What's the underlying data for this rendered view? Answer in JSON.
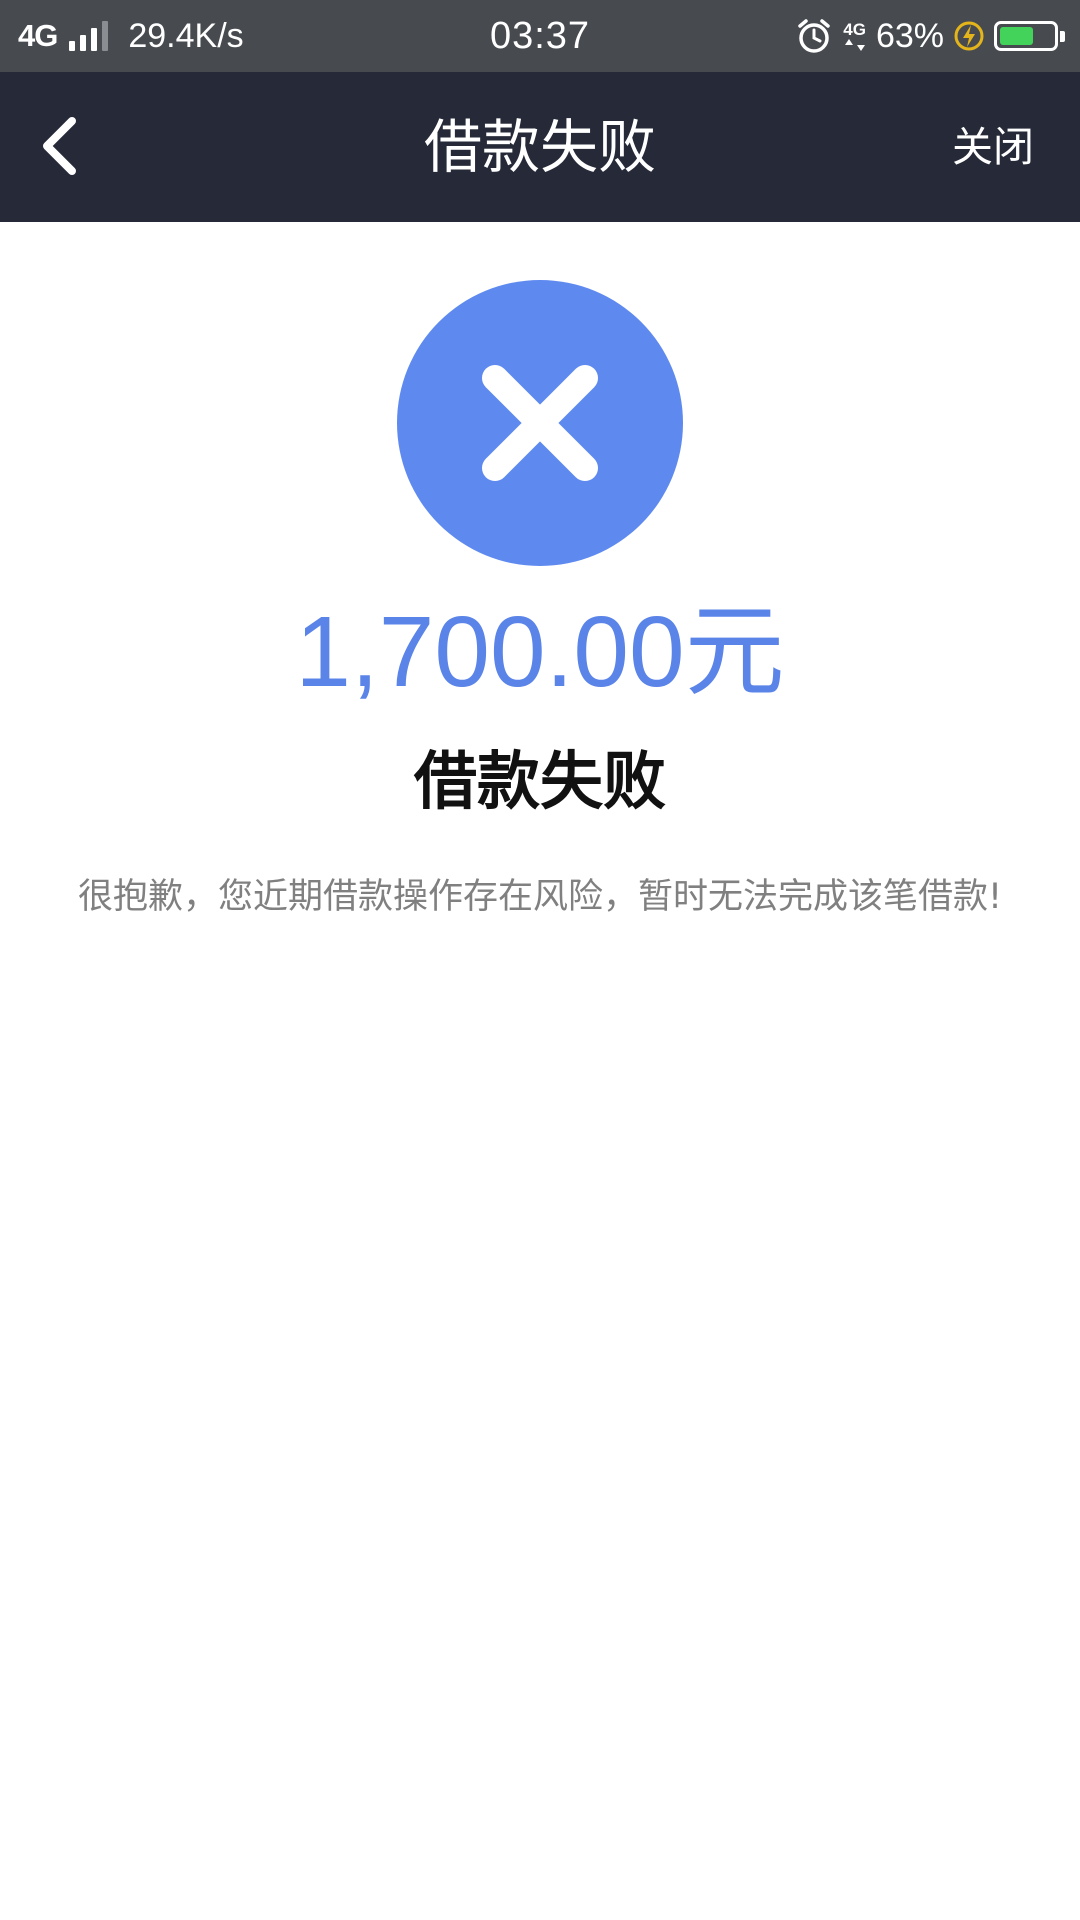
{
  "status_bar": {
    "network": "4G",
    "speed": "29.4K/s",
    "time": "03:37",
    "data_network": "4G",
    "battery_percent": "63%",
    "battery_level": 0.63
  },
  "nav": {
    "title": "借款失败",
    "close_label": "关闭"
  },
  "result": {
    "amount": "1,700.00元",
    "title": "借款失败",
    "message": "很抱歉，您近期借款操作存在风险，暂时无法完成该笔借款!"
  },
  "colors": {
    "nav_background": "#252938",
    "status_bar_background": "#474b50",
    "accent_blue": "#5b84e8",
    "battery_green": "#44d35a"
  },
  "icons": {
    "back": "chevron-left-icon",
    "fail": "close-circle-icon",
    "alarm": "alarm-clock-icon",
    "charging": "lightning-icon"
  }
}
